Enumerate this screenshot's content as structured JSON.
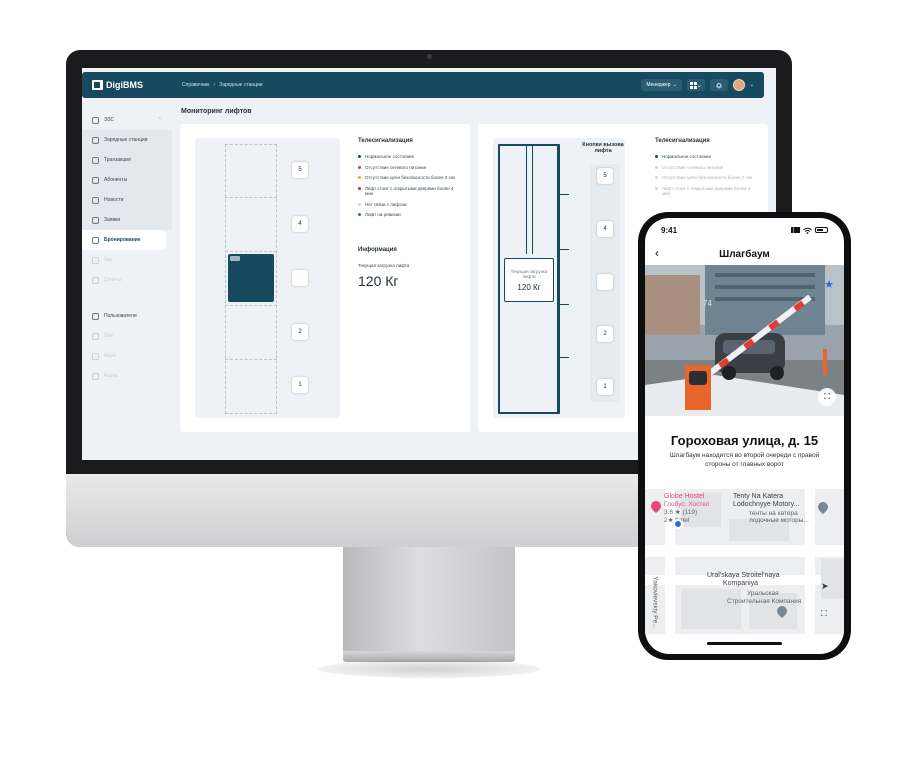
{
  "app": {
    "logo": "DigiBMS",
    "breadcrumb": [
      "Справочник",
      "›",
      "Зарядные станции"
    ],
    "role": "Менеджер",
    "role_caret": "⌄",
    "apps_caret": "⌄",
    "avatar_caret": "⌄"
  },
  "sidebar": {
    "items": [
      {
        "label": "ЭЗС",
        "chevron": "⌃"
      },
      {
        "label": "Зарядные станции"
      },
      {
        "label": "Транзакции"
      },
      {
        "label": "Абоненты"
      },
      {
        "label": "Новости"
      },
      {
        "label": "Заявки"
      },
      {
        "label": "Бронирование"
      },
      {
        "label": "Чат"
      },
      {
        "label": "Отчеты"
      },
      {
        "label": "Пользователи"
      },
      {
        "label": "Шаг"
      },
      {
        "label": "Фаза"
      },
      {
        "label": "Карта"
      }
    ],
    "active": "Бронирование"
  },
  "page": {
    "title": "Мониторинг лифтов"
  },
  "left_panel": {
    "floors": [
      "5",
      "4",
      "",
      "2",
      "1"
    ],
    "tele_title": "Телесигнализация",
    "legend": [
      {
        "label": "Нормальное состояние",
        "color": "#17495f"
      },
      {
        "label": "Отсутствие сетевого питания",
        "color": "#e53935"
      },
      {
        "label": "Отсутствие цепи безопасности более 2 сек",
        "color": "#f5a623"
      },
      {
        "label": "Лифт стоит с открытыми дверями более 4 мин",
        "color": "#d81b60"
      },
      {
        "label": "Нет связи с лифтом",
        "color": "#cfd8dc"
      },
      {
        "label": "Лифт на ревизии",
        "color": "#2e6bd9"
      }
    ],
    "info_title": "Информация",
    "load_label": "Текущая загрузка лифта",
    "load_value": "120 Кг"
  },
  "right_panel": {
    "call_title": "Кнопки вызова лифта",
    "floors": [
      "5",
      "4",
      "",
      "2",
      "1"
    ],
    "load_label": "Текущая загрузка лифта",
    "load_value": "120 Кг",
    "tele_title": "Телесигнализация",
    "legend": [
      {
        "label": "Нормальное состояние",
        "color": "#17495f"
      },
      {
        "label": "Отсутствие сетевого питания",
        "color": "#cfd8dc"
      },
      {
        "label": "Отсутствие цепи безопасности более 2 сек",
        "color": "#cfd8dc"
      },
      {
        "label": "Лифт стоит с открытыми дверями более 4 мин",
        "color": "#cfd8dc"
      }
    ]
  },
  "phone": {
    "time": "9:41",
    "title": "Шлагбаум",
    "back": "‹",
    "address": "Гороховая улица, д. 15",
    "description": "Шлагбаум находится во второй очереди с правой стороны от главных ворот",
    "photo_overlay": "74",
    "map": {
      "globe_name": "Globe Hostel",
      "globe_ru": "Глобус. Хостел",
      "globe_rating": "3.6 ★ (119)",
      "globe_type": "2★ hotel",
      "tenty": "Tenty Na Katera",
      "tenty_2": "Lodochnyye Motory...",
      "tenty_ru": "тенты на катера",
      "tenty_ru_2": "лодочные моторы...",
      "ural": "Ural'skaya Stroitel'naya",
      "ural_2": "Kompaniya",
      "ural_ru": "Уральская",
      "ural_ru_2": "Строительная Компания",
      "street": "Yakovlevskiy Pe..."
    }
  }
}
